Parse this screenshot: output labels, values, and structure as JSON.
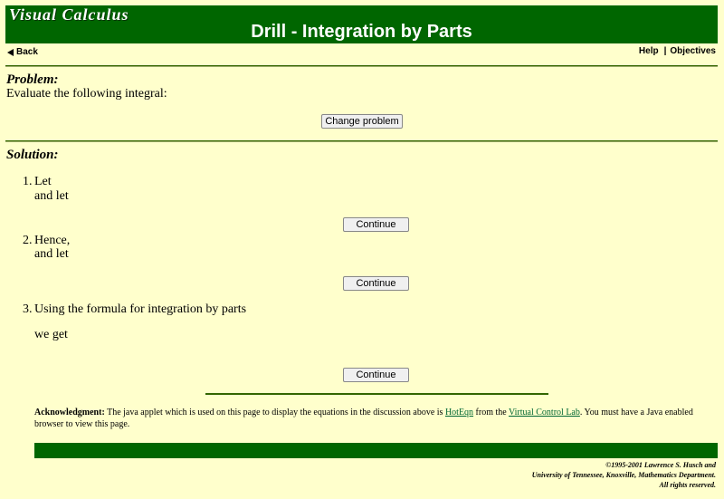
{
  "header": {
    "logo_text": "Visual Calculus",
    "title": "Drill - Integration by Parts"
  },
  "nav": {
    "back_label": "Back",
    "help_label": "Help",
    "separator": "|",
    "objectives_label": "Objectives"
  },
  "problem": {
    "heading": "Problem:",
    "prompt": "Evaluate the following integral:",
    "change_button": "Change problem"
  },
  "solution": {
    "heading": "Solution:",
    "steps": [
      {
        "num": "1.",
        "line1": "Let",
        "line2": "and let",
        "button": "Continue"
      },
      {
        "num": "2.",
        "line1": "Hence,",
        "line2": "and let",
        "button": "Continue"
      },
      {
        "num": "3.",
        "line1": "Using the formula for integration by parts",
        "line2": "we get",
        "button": "Continue"
      }
    ]
  },
  "acknowledgment": {
    "label": "Acknowledgment:",
    "text_before": "The java applet which is used on this page to display the equations in the discussion above is",
    "link1": "HotEqn",
    "text_middle": "from the",
    "link2": "Virtual Control Lab",
    "text_after": ". You must have a Java enabled browser to view this page."
  },
  "footer": {
    "line1": "©1995-2001 Lawrence S. Husch and",
    "line2": "University of Tennessee, Knoxville, Mathematics Department.",
    "line3": "All rights reserved."
  },
  "colors": {
    "background": "#ffffcc",
    "brand_green": "#006600"
  }
}
